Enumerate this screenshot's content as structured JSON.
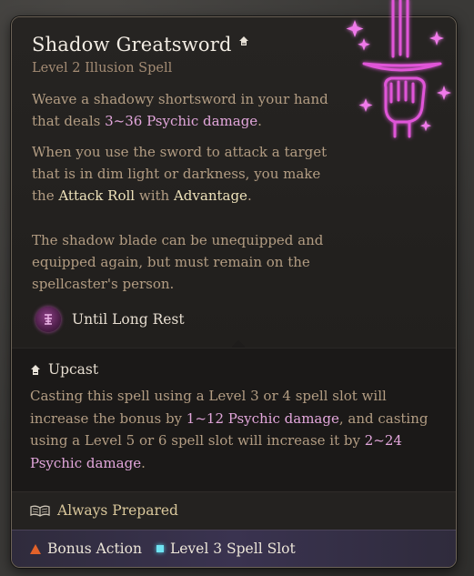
{
  "spell": {
    "title": "Shadow Greatsword",
    "subtitle": "Level 2 Illusion Spell",
    "desc1_a": "Weave a shadowy shortsword in your hand that deals ",
    "desc1_dmg": "3~36 Psychic damage",
    "desc1_b": ".",
    "desc2_a": "When you use the sword to attack a target that is in dim light or darkness, you make the ",
    "desc2_attack": "Attack Roll",
    "desc2_with": " with ",
    "desc2_adv": "Advantage",
    "desc2_b": ".",
    "desc3": "The shadow blade can be unequipped and equipped again, but must remain on the spellcaster's person.",
    "duration": "Until Long Rest"
  },
  "upcast": {
    "label": "Upcast",
    "text_a": "Casting this spell using a Level 3 or 4 spell slot will increase the bonus by ",
    "dmg1": "1~12 Psychic damage",
    "text_b": ", and casting using a Level 5 or 6 spell slot will increase it by ",
    "dmg2": "2~24 Psychic damage",
    "text_c": "."
  },
  "prepared": {
    "label": "Always Prepared"
  },
  "cost": {
    "bonus_action": "Bonus Action",
    "spell_slot": "Level 3 Spell Slot"
  },
  "colors": {
    "psychic": "#e3a7dc",
    "keyword": "#ede1b9",
    "body": "#b39d83",
    "bonus_action": "#e2622a",
    "spell_slot": "#6fe3f2",
    "art_glow": "#e055d8"
  },
  "icons": {
    "title": "upcast-icon",
    "duration": "psychic-rune-icon",
    "upcast": "upcast-icon",
    "prepared": "open-book-icon",
    "bonus_action": "triangle-icon",
    "spell_slot": "square-slot-icon",
    "art": "shadow-blade-fist-icon"
  }
}
